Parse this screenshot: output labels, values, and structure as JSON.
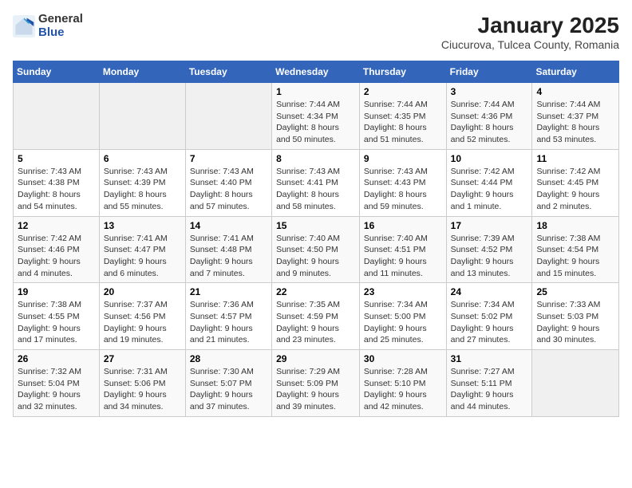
{
  "header": {
    "logo_general": "General",
    "logo_blue": "Blue",
    "title": "January 2025",
    "subtitle": "Ciucurova, Tulcea County, Romania"
  },
  "weekdays": [
    "Sunday",
    "Monday",
    "Tuesday",
    "Wednesday",
    "Thursday",
    "Friday",
    "Saturday"
  ],
  "weeks": [
    [
      {
        "day": "",
        "info": ""
      },
      {
        "day": "",
        "info": ""
      },
      {
        "day": "",
        "info": ""
      },
      {
        "day": "1",
        "info": "Sunrise: 7:44 AM\nSunset: 4:34 PM\nDaylight: 8 hours\nand 50 minutes."
      },
      {
        "day": "2",
        "info": "Sunrise: 7:44 AM\nSunset: 4:35 PM\nDaylight: 8 hours\nand 51 minutes."
      },
      {
        "day": "3",
        "info": "Sunrise: 7:44 AM\nSunset: 4:36 PM\nDaylight: 8 hours\nand 52 minutes."
      },
      {
        "day": "4",
        "info": "Sunrise: 7:44 AM\nSunset: 4:37 PM\nDaylight: 8 hours\nand 53 minutes."
      }
    ],
    [
      {
        "day": "5",
        "info": "Sunrise: 7:43 AM\nSunset: 4:38 PM\nDaylight: 8 hours\nand 54 minutes."
      },
      {
        "day": "6",
        "info": "Sunrise: 7:43 AM\nSunset: 4:39 PM\nDaylight: 8 hours\nand 55 minutes."
      },
      {
        "day": "7",
        "info": "Sunrise: 7:43 AM\nSunset: 4:40 PM\nDaylight: 8 hours\nand 57 minutes."
      },
      {
        "day": "8",
        "info": "Sunrise: 7:43 AM\nSunset: 4:41 PM\nDaylight: 8 hours\nand 58 minutes."
      },
      {
        "day": "9",
        "info": "Sunrise: 7:43 AM\nSunset: 4:43 PM\nDaylight: 8 hours\nand 59 minutes."
      },
      {
        "day": "10",
        "info": "Sunrise: 7:42 AM\nSunset: 4:44 PM\nDaylight: 9 hours\nand 1 minute."
      },
      {
        "day": "11",
        "info": "Sunrise: 7:42 AM\nSunset: 4:45 PM\nDaylight: 9 hours\nand 2 minutes."
      }
    ],
    [
      {
        "day": "12",
        "info": "Sunrise: 7:42 AM\nSunset: 4:46 PM\nDaylight: 9 hours\nand 4 minutes."
      },
      {
        "day": "13",
        "info": "Sunrise: 7:41 AM\nSunset: 4:47 PM\nDaylight: 9 hours\nand 6 minutes."
      },
      {
        "day": "14",
        "info": "Sunrise: 7:41 AM\nSunset: 4:48 PM\nDaylight: 9 hours\nand 7 minutes."
      },
      {
        "day": "15",
        "info": "Sunrise: 7:40 AM\nSunset: 4:50 PM\nDaylight: 9 hours\nand 9 minutes."
      },
      {
        "day": "16",
        "info": "Sunrise: 7:40 AM\nSunset: 4:51 PM\nDaylight: 9 hours\nand 11 minutes."
      },
      {
        "day": "17",
        "info": "Sunrise: 7:39 AM\nSunset: 4:52 PM\nDaylight: 9 hours\nand 13 minutes."
      },
      {
        "day": "18",
        "info": "Sunrise: 7:38 AM\nSunset: 4:54 PM\nDaylight: 9 hours\nand 15 minutes."
      }
    ],
    [
      {
        "day": "19",
        "info": "Sunrise: 7:38 AM\nSunset: 4:55 PM\nDaylight: 9 hours\nand 17 minutes."
      },
      {
        "day": "20",
        "info": "Sunrise: 7:37 AM\nSunset: 4:56 PM\nDaylight: 9 hours\nand 19 minutes."
      },
      {
        "day": "21",
        "info": "Sunrise: 7:36 AM\nSunset: 4:57 PM\nDaylight: 9 hours\nand 21 minutes."
      },
      {
        "day": "22",
        "info": "Sunrise: 7:35 AM\nSunset: 4:59 PM\nDaylight: 9 hours\nand 23 minutes."
      },
      {
        "day": "23",
        "info": "Sunrise: 7:34 AM\nSunset: 5:00 PM\nDaylight: 9 hours\nand 25 minutes."
      },
      {
        "day": "24",
        "info": "Sunrise: 7:34 AM\nSunset: 5:02 PM\nDaylight: 9 hours\nand 27 minutes."
      },
      {
        "day": "25",
        "info": "Sunrise: 7:33 AM\nSunset: 5:03 PM\nDaylight: 9 hours\nand 30 minutes."
      }
    ],
    [
      {
        "day": "26",
        "info": "Sunrise: 7:32 AM\nSunset: 5:04 PM\nDaylight: 9 hours\nand 32 minutes."
      },
      {
        "day": "27",
        "info": "Sunrise: 7:31 AM\nSunset: 5:06 PM\nDaylight: 9 hours\nand 34 minutes."
      },
      {
        "day": "28",
        "info": "Sunrise: 7:30 AM\nSunset: 5:07 PM\nDaylight: 9 hours\nand 37 minutes."
      },
      {
        "day": "29",
        "info": "Sunrise: 7:29 AM\nSunset: 5:09 PM\nDaylight: 9 hours\nand 39 minutes."
      },
      {
        "day": "30",
        "info": "Sunrise: 7:28 AM\nSunset: 5:10 PM\nDaylight: 9 hours\nand 42 minutes."
      },
      {
        "day": "31",
        "info": "Sunrise: 7:27 AM\nSunset: 5:11 PM\nDaylight: 9 hours\nand 44 minutes."
      },
      {
        "day": "",
        "info": ""
      }
    ]
  ]
}
